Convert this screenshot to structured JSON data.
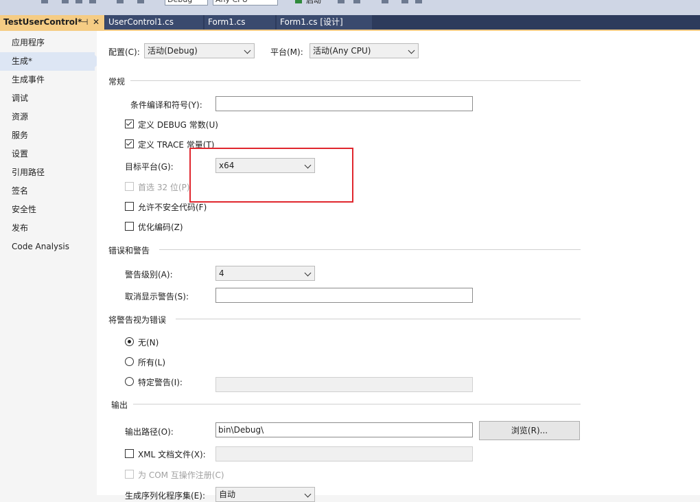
{
  "toolbar": {
    "config_combo": "Debug",
    "platform_combo": "Any CPU",
    "start_label": "启动"
  },
  "tabs": {
    "project": {
      "label": "TestUserControl*",
      "pin": "⊣",
      "close": "✕"
    },
    "others": [
      {
        "label": "UserControl1.cs"
      },
      {
        "label": "Form1.cs"
      },
      {
        "label": "Form1.cs [设计]"
      }
    ]
  },
  "sidebar": {
    "items": [
      {
        "label": "应用程序"
      },
      {
        "label": "生成*"
      },
      {
        "label": "生成事件"
      },
      {
        "label": "调试"
      },
      {
        "label": "资源"
      },
      {
        "label": "服务"
      },
      {
        "label": "设置"
      },
      {
        "label": "引用路径"
      },
      {
        "label": "签名"
      },
      {
        "label": "安全性"
      },
      {
        "label": "发布"
      },
      {
        "label": "Code Analysis"
      }
    ]
  },
  "header": {
    "config_label": "配置(C):",
    "config_value": "活动(Debug)",
    "platform_label": "平台(M):",
    "platform_value": "活动(Any CPU)"
  },
  "general": {
    "section": "常规",
    "symbols_label": "条件编译和符号(Y):",
    "symbols_value": "",
    "define_debug": "定义 DEBUG 常数(U)",
    "define_trace": "定义 TRACE 常量(T)",
    "target_label": "目标平台(G):",
    "target_value": "x64",
    "prefer32": "首选 32 位(P)",
    "unsafe": "允许不安全代码(F)",
    "optimize": "优化编码(Z)"
  },
  "errors": {
    "section": "错误和警告",
    "level_label": "警告级别(A):",
    "level_value": "4",
    "suppress_label": "取消显示警告(S):",
    "suppress_value": ""
  },
  "treat": {
    "section": "将警告视为错误",
    "none": "无(N)",
    "all": "所有(L)",
    "specific": "特定警告(I):"
  },
  "output": {
    "section": "输出",
    "path_label": "输出路径(O):",
    "path_value": "bin\\Debug\\",
    "browse": "浏览(R)...",
    "xml_doc": "XML 文档文件(X):",
    "com": "为 COM 互操作注册(C)",
    "serial_label": "生成序列化程序集(E):",
    "serial_value": "自动"
  },
  "colors": {
    "highlight": "#e0262d",
    "tab_active": "#f5cc84",
    "tabstrip": "#2d3b5c"
  }
}
